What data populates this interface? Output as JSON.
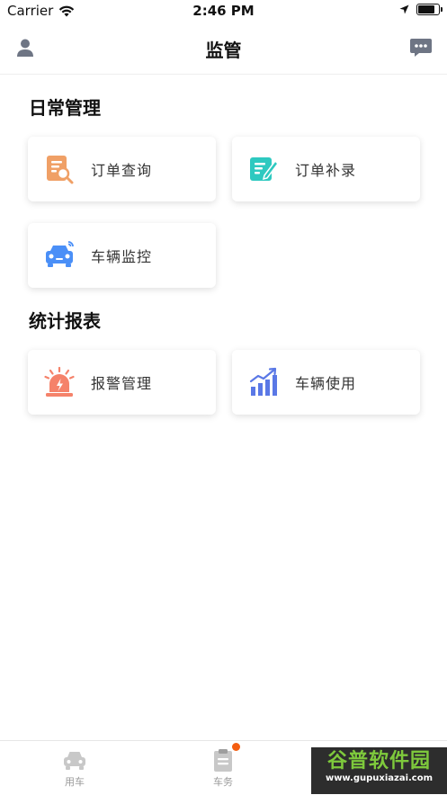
{
  "status_bar": {
    "carrier": "Carrier",
    "time": "2:46 PM",
    "battery_level": 0.9
  },
  "header": {
    "title": "监管",
    "left_icon": "user-icon",
    "right_icon": "message-icon"
  },
  "sections": [
    {
      "title": "日常管理",
      "items": [
        {
          "label": "订单查询",
          "icon": "order-search-icon",
          "color": "#f0a066"
        },
        {
          "label": "订单补录",
          "icon": "order-edit-icon",
          "color": "#2ec9c0"
        },
        {
          "label": "车辆监控",
          "icon": "car-monitor-icon",
          "color": "#4a8ff7"
        }
      ]
    },
    {
      "title": "统计报表",
      "items": [
        {
          "label": "报警管理",
          "icon": "alarm-icon",
          "color": "#f5826a"
        },
        {
          "label": "车辆使用",
          "icon": "usage-chart-icon",
          "color": "#5a78e6"
        }
      ]
    }
  ],
  "tabbar": {
    "tabs": [
      {
        "label": "用车",
        "icon": "car-icon"
      },
      {
        "label": "车务",
        "icon": "clipboard-icon",
        "badge": true
      }
    ]
  },
  "watermark": {
    "main": "谷普软件园",
    "sub": "www.gupuxiazai.com"
  }
}
